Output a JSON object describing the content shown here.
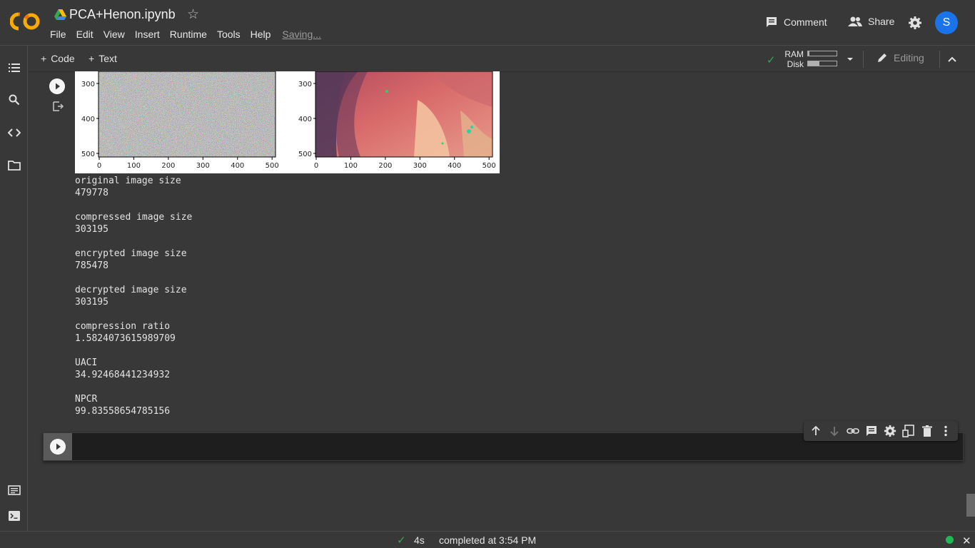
{
  "header": {
    "title": "PCA+Henon.ipynb",
    "menu": [
      "File",
      "Edit",
      "View",
      "Insert",
      "Runtime",
      "Tools",
      "Help"
    ],
    "saving_label": "Saving...",
    "comment_label": "Comment",
    "share_label": "Share",
    "avatar_initial": "S"
  },
  "toolbar": {
    "add_code_label": "Code",
    "add_text_label": "Text",
    "ram_label": "RAM",
    "disk_label": "Disk",
    "ram_usage": 0.04,
    "disk_usage": 0.4,
    "editing_label": "Editing"
  },
  "plots": {
    "left": {
      "y_ticks": [
        "300",
        "400",
        "500"
      ],
      "x_ticks": [
        "0",
        "100",
        "200",
        "300",
        "400",
        "500"
      ]
    },
    "right": {
      "y_ticks": [
        "300",
        "400",
        "500"
      ],
      "x_ticks": [
        "0",
        "100",
        "200",
        "300",
        "400",
        "500"
      ]
    }
  },
  "output": [
    {
      "label": "original image size",
      "value": "479778"
    },
    {
      "label": "compressed image size",
      "value": "303195"
    },
    {
      "label": "encrypted image size",
      "value": "785478"
    },
    {
      "label": "decrypted image size",
      "value": "303195"
    },
    {
      "label": "compression ratio",
      "value": "1.5824073615989709"
    },
    {
      "label": "UACI",
      "value": "34.92468441234932"
    },
    {
      "label": "NPCR",
      "value": "99.83558654785156"
    }
  ],
  "status": {
    "duration": "4s",
    "text": "completed at 3:54 PM"
  },
  "colors": {
    "background": "#383838",
    "accent_blue": "#1a73e8",
    "success_green": "#34a853"
  },
  "icons": [
    "colab-logo-icon",
    "drive-icon",
    "star-icon",
    "comment-icon",
    "share-icon",
    "gear-icon",
    "toc-icon",
    "search-icon",
    "code-snippets-icon",
    "folder-icon",
    "command-palette-icon",
    "terminal-icon",
    "play-icon",
    "output-menu-icon",
    "arrow-up-icon",
    "arrow-down-icon",
    "link-icon",
    "comment-icon",
    "settings-icon",
    "mirror-cell-icon",
    "trash-icon",
    "more-vert-icon",
    "check-icon",
    "pencil-icon",
    "chevron-up-icon",
    "caret-down-icon",
    "close-icon"
  ]
}
